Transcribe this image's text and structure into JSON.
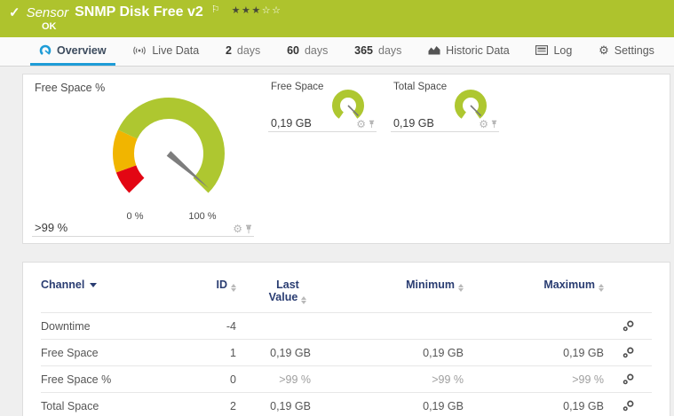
{
  "icons": {
    "check": "✓",
    "flag": "⚐",
    "gear": "⚙"
  },
  "header": {
    "kind": "Sensor",
    "title": "SNMP Disk Free v2",
    "status": "OK",
    "stars_filled": "★★★",
    "stars_empty": "☆☆"
  },
  "tabs": {
    "overview": {
      "label": "Overview"
    },
    "live_data": {
      "label": "Live Data"
    },
    "days2": {
      "num": "2",
      "unit": "days"
    },
    "days60": {
      "num": "60",
      "unit": "days"
    },
    "days365": {
      "num": "365",
      "unit": "days"
    },
    "historic": {
      "label": "Historic Data"
    },
    "log": {
      "label": "Log"
    },
    "settings": {
      "label": "Settings"
    }
  },
  "gauges": {
    "main": {
      "title": "Free Space %",
      "value": ">99 %",
      "percent": 99,
      "scale_min": "0 %",
      "scale_max": "100 %"
    },
    "free_space": {
      "title": "Free Space",
      "value": "0,19 GB"
    },
    "total_space": {
      "title": "Total Space",
      "value": "0,19 GB"
    }
  },
  "table": {
    "headers": {
      "channel": "Channel",
      "id": "ID",
      "last": "Last Value",
      "min": "Minimum",
      "max": "Maximum"
    },
    "rows": [
      {
        "channel": "Downtime",
        "id": "-4",
        "last": "",
        "min": "",
        "max": ""
      },
      {
        "channel": "Free Space",
        "id": "1",
        "last": "0,19 GB",
        "min": "0,19 GB",
        "max": "0,19 GB"
      },
      {
        "channel": "Free Space %",
        "id": "0",
        "last": ">99 %",
        "min": ">99 %",
        "max": ">99 %"
      },
      {
        "channel": "Total Space",
        "id": "2",
        "last": "0,19 GB",
        "min": "0,19 GB",
        "max": "0,19 GB"
      }
    ]
  },
  "colors": {
    "header_green": "#aec32d",
    "accent_blue": "#1e9cd7",
    "table_header_navy": "#2a3d72",
    "gauge_green": "#aec730",
    "gauge_yellow": "#f1b500",
    "gauge_red": "#e30613",
    "needle_gray": "#7d7d7d"
  }
}
